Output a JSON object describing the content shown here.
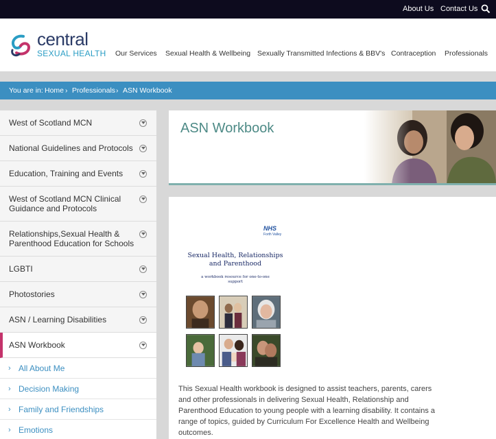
{
  "topbar": {
    "about_label": "About Us",
    "contact_label": "Contact Us",
    "search_icon": "search-icon"
  },
  "logo": {
    "line1": "central",
    "line2": "SEXUAL HEALTH"
  },
  "nav": {
    "items": [
      {
        "label": "Our Services"
      },
      {
        "label": "Sexual Health & Wellbeing"
      },
      {
        "label": "Sexually Transmitted Infections & BBV's"
      },
      {
        "label": "Contraception"
      },
      {
        "label": "Professionals"
      }
    ]
  },
  "breadcrumb": {
    "prefix": "You are in:",
    "items": [
      "Home",
      "Professionals",
      "ASN Workbook"
    ]
  },
  "sidebar": {
    "items": [
      {
        "label": "West of Scotland MCN"
      },
      {
        "label": "National Guidelines and Protocols"
      },
      {
        "label": "Education, Training and Events"
      },
      {
        "label": "West of Scotland MCN Clinical\nGuidance and Protocols"
      },
      {
        "label": "Relationships,Sexual Health &\nParenthood Education for Schools"
      },
      {
        "label": "LGBTI"
      },
      {
        "label": "Photostories"
      },
      {
        "label": "ASN / Learning Disabilities"
      },
      {
        "label": "ASN Workbook"
      }
    ],
    "subitems": [
      {
        "label": "All About Me"
      },
      {
        "label": "Decision Making"
      },
      {
        "label": "Family and Friendships"
      },
      {
        "label": "Emotions"
      }
    ]
  },
  "main": {
    "title": "ASN Workbook",
    "book": {
      "nhs": "NHS",
      "board": "Forth Valley",
      "title": "Sexual Health, Relationships\nand Parenthood",
      "subtitle": "a workbook resource for one-to-one\nsupport"
    },
    "description": "This Sexual Health workbook is designed to assist teachers, parents, carers and other professionals in delivering Sexual Health, Relationship and Parenthood Education to young people with a learning disability. It contains a range of topics, guided by Curriculum For Excellence Health and Wellbeing outcomes."
  },
  "colors": {
    "topbar": "#0d0b1e",
    "accent_blue": "#3c8fc1",
    "accent_pink": "#c4336b",
    "title_teal": "#4d8a86"
  }
}
